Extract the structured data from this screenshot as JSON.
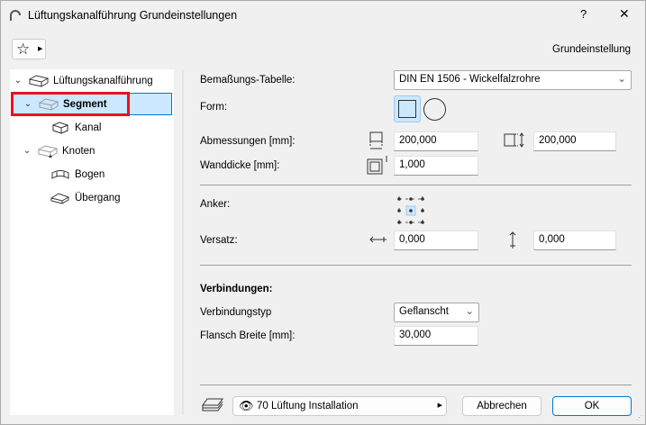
{
  "window": {
    "title": "Lüftungskanalführung Grundeinstellungen",
    "help": "?",
    "close": "✕"
  },
  "header": {
    "mode_label": "Grundeinstellung"
  },
  "tree": [
    {
      "label": "Lüftungskanalführung",
      "level": 0,
      "expanded": true
    },
    {
      "label": "Segment",
      "level": 1,
      "expanded": true,
      "selected": true
    },
    {
      "label": "Kanal",
      "level": 2
    },
    {
      "label": "Knoten",
      "level": 1,
      "expanded": true
    },
    {
      "label": "Bogen",
      "level": 2
    },
    {
      "label": "Übergang",
      "level": 2
    }
  ],
  "form": {
    "table_label": "Bemaßungs-Tabelle:",
    "table_value": "DIN EN 1506 - Wickelfalzrohre",
    "shape_label": "Form:",
    "dims_label": "Abmessungen [mm]:",
    "width_value": "200,000",
    "height_value": "200,000",
    "wall_label": "Wanddicke [mm]:",
    "wall_value": "1,000",
    "anchor_label": "Anker:",
    "offset_label": "Versatz:",
    "offset_x": "0,000",
    "offset_y": "0,000",
    "connections_heading": "Verbindungen:",
    "conn_type_label": "Verbindungstyp",
    "conn_type_value": "Geflanscht",
    "flange_label": "Flansch Breite [mm]:",
    "flange_value": "30,000"
  },
  "footer": {
    "layer": "70 Lüftung Installation",
    "cancel": "Abbrechen",
    "ok": "OK"
  },
  "colors": {
    "selection": "#cce8ff",
    "accent": "#0078d7",
    "highlight_box": "#e81123"
  }
}
